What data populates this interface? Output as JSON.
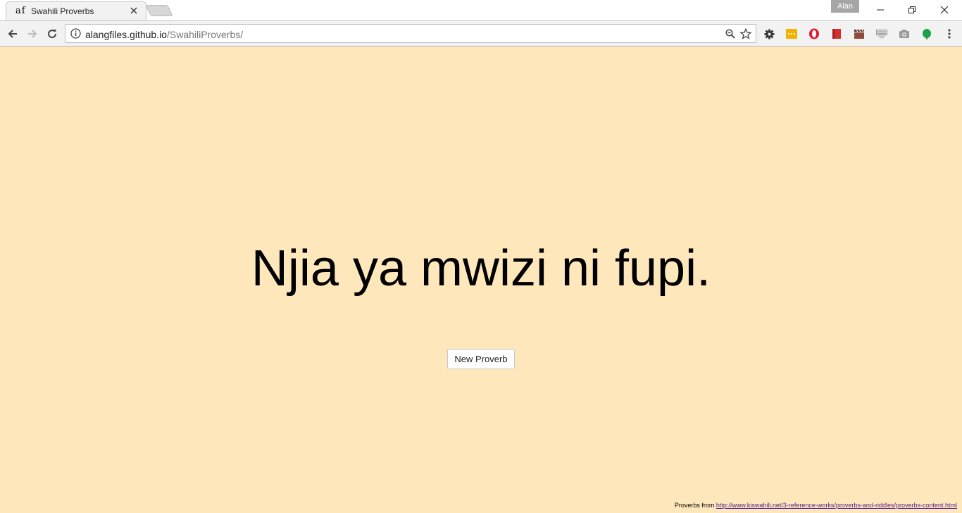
{
  "browser": {
    "tab": {
      "favicon_text": "af",
      "title": "Swahili Proverbs"
    },
    "profile_name": "Alan",
    "address": {
      "host": "alangfiles.github.io",
      "path": "/SwahiliProverbs/"
    },
    "toolbar_icons": [
      "gear-icon",
      "yellow-extension-icon",
      "opera-icon",
      "red-book-icon",
      "clapperboard-icon",
      "keyboard-icon",
      "camera-icon",
      "green-leaf-icon",
      "menu-icon"
    ]
  },
  "page": {
    "proverb": "Njia ya mwizi ni fupi.",
    "new_button_label": "New Proverb",
    "footer": {
      "prefix": "Proverbs from ",
      "link_text": "http://www.kiswahili.net/3-reference-works/proverbs-and-riddles/proverbs-content.html"
    },
    "background_color": "#ffe7bc"
  }
}
